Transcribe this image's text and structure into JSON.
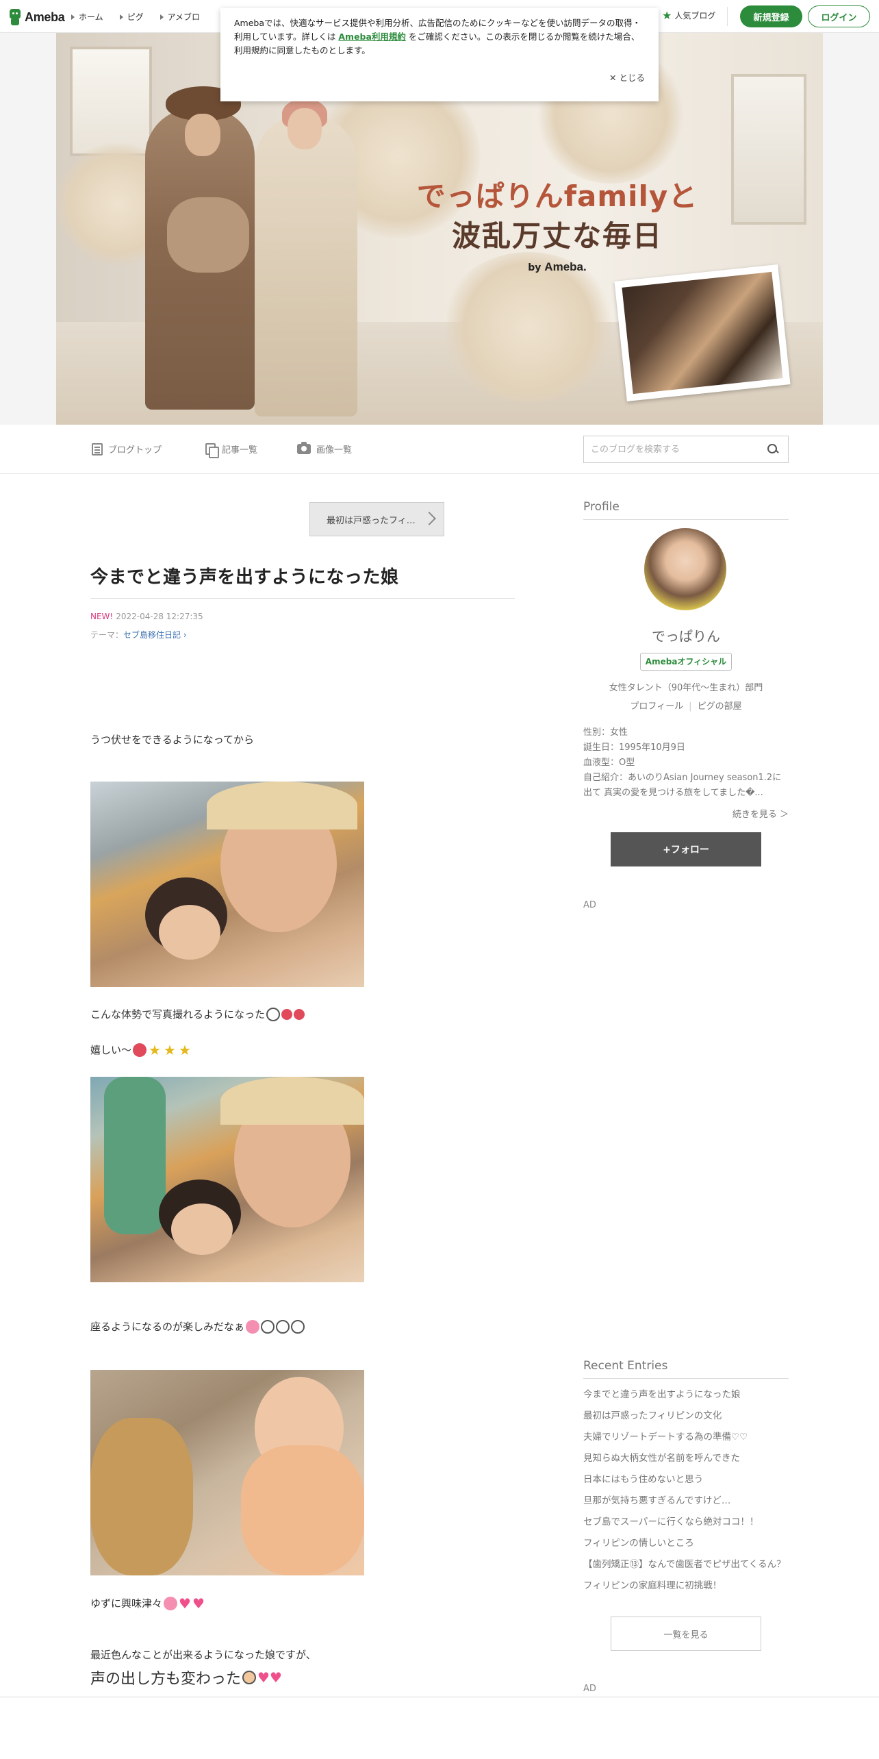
{
  "header": {
    "logo_text": "Ameba",
    "nav": [
      "ホーム",
      "ピグ",
      "アメブロ"
    ],
    "popular_label": "人気ブログ",
    "signup_label": "新規登録",
    "login_label": "ログイン"
  },
  "cookie": {
    "text_before": "Amebaでは、快適なサービス提供や利用分析、広告配信のためにクッキーなどを使い訪問データの取得・利用しています。詳しくは",
    "link": "Ameba利用規約",
    "text_after": "をご確認ください。この表示を閉じるか閲覧を続けた場合、利用規約に同意したものとします。",
    "close_label": "とじる"
  },
  "banner": {
    "title_line1": "でっぱりんfamilyと",
    "title_line2": "波乱万丈な毎日",
    "by": "by",
    "brand": "Ameba."
  },
  "blog_nav": {
    "top": "ブログトップ",
    "entries": "記事一覧",
    "images": "画像一覧",
    "search_placeholder": "このブログを検索する"
  },
  "entry": {
    "prev_label": "最初は戸惑ったフィ…",
    "title": "今までと違う声を出すようになった娘",
    "new_badge": "NEW!",
    "date": "2022-04-28 12:27:35",
    "theme_label": "テーマ：",
    "theme": "セブ島移住日記",
    "p1": "うつ伏せをできるようになってから",
    "p2": "こんな体勢で写真撮れるようになった",
    "p3": "嬉しい〜",
    "p4": "座るようになるのが楽しみだなぁ",
    "p5": "ゆずに興味津々",
    "p6": "最近色んなことが出来るようになった娘ですが、",
    "p7": "声の出し方も変わった"
  },
  "sidebar": {
    "profile_heading": "Profile",
    "name": "でっぱりん",
    "official_badge": "Amebaオフィシャル",
    "category": "女性タレント（90年代～生まれ）部門",
    "link_profile": "プロフィール",
    "link_room": "ピグの部屋",
    "info": [
      "性別：女性",
      "誕生日：1995年10月9日",
      "血液型：O型",
      "自己紹介：あいのりAsian Journey season1.2に出て 真実の愛を見つける旅をしてました�..."
    ],
    "more_label": "続きを見る ＞",
    "follow_label": "+フォロー",
    "ad_label": "AD",
    "recent_heading": "Recent Entries",
    "recent": [
      "今までと違う声を出すようになった娘",
      "最初は戸惑ったフィリピンの文化",
      "夫婦でリゾートデートする為の準備♡♡",
      "見知らぬ大柄女性が名前を呼んできた",
      "日本にはもう住めないと思う",
      "旦那が気持ち悪すぎるんですけど…",
      "セブ島でスーパーに行くなら絶対ココ！！",
      "フィリピンの情しいところ",
      "【歯列矯正⑬】なんで歯医者でピザ出てくるん？",
      "フィリピンの家庭料理に初挑戦！"
    ],
    "list_label": "一覧を見る",
    "ad_label2": "AD"
  },
  "colors": {
    "brand_green": "#2d8c3c",
    "new_pink": "#d63b7d",
    "theme_link": "#3a6fb0"
  }
}
